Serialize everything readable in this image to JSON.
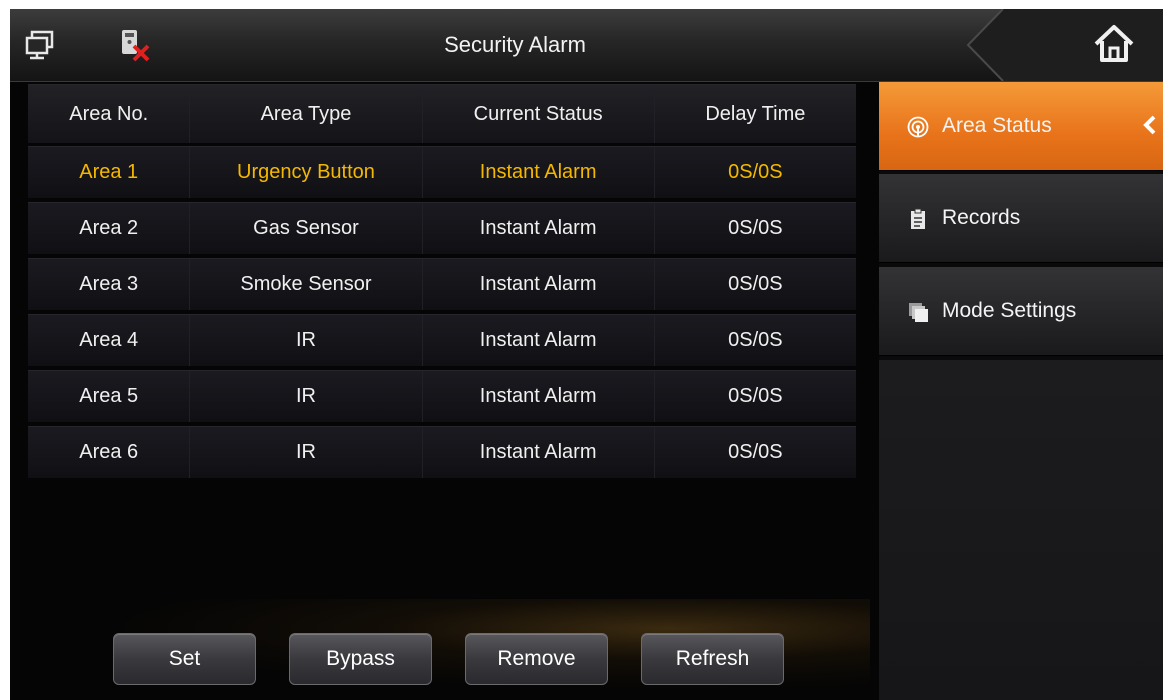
{
  "titlebar": {
    "title": "Security Alarm",
    "left_icons": [
      "monitor-icon",
      "network-disconnected-icon"
    ],
    "home_icon": "home-icon"
  },
  "table": {
    "headers": [
      "Area No.",
      "Area Type",
      "Current Status",
      "Delay Time"
    ],
    "rows": [
      {
        "area": "Area 1",
        "type": "Urgency Button",
        "status": "Instant Alarm",
        "delay": "0S/0S",
        "selected": true
      },
      {
        "area": "Area 2",
        "type": "Gas Sensor",
        "status": "Instant Alarm",
        "delay": "0S/0S"
      },
      {
        "area": "Area 3",
        "type": "Smoke Sensor",
        "status": "Instant Alarm",
        "delay": "0S/0S"
      },
      {
        "area": "Area 4",
        "type": "IR",
        "status": "Instant Alarm",
        "delay": "0S/0S"
      },
      {
        "area": "Area 5",
        "type": "IR",
        "status": "Instant Alarm",
        "delay": "0S/0S"
      },
      {
        "area": "Area 6",
        "type": "IR",
        "status": "Instant Alarm",
        "delay": "0S/0S"
      }
    ]
  },
  "buttons": {
    "set": "Set",
    "bypass": "Bypass",
    "remove": "Remove",
    "refresh": "Refresh"
  },
  "sidebar": {
    "items": [
      {
        "label": "Area Status",
        "icon": "area-status-icon",
        "active": true
      },
      {
        "label": "Records",
        "icon": "clipboard-icon"
      },
      {
        "label": "Mode Settings",
        "icon": "mode-settings-icon"
      }
    ]
  },
  "colors": {
    "accent": "#F08A2A",
    "selected_text": "#F5B800",
    "background": "#050505"
  }
}
